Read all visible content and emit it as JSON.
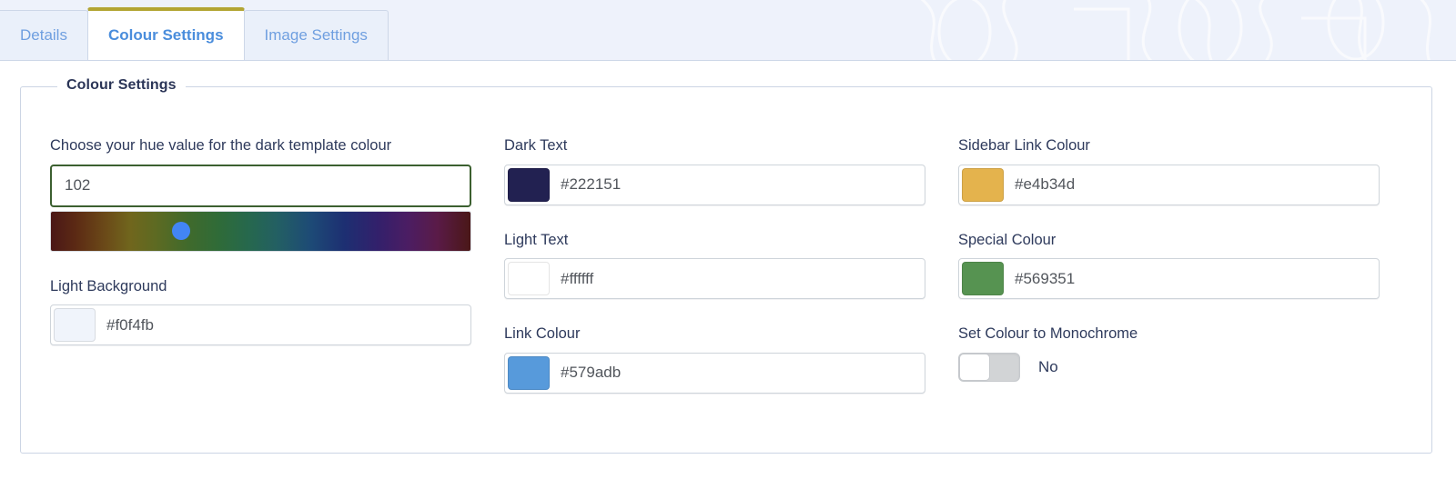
{
  "tabs": [
    {
      "label": "Details",
      "active": false
    },
    {
      "label": "Colour Settings",
      "active": true
    },
    {
      "label": "Image Settings",
      "active": false
    }
  ],
  "fieldset": {
    "legend": "Colour Settings"
  },
  "columns": {
    "left": {
      "hue": {
        "label": "Choose your hue value for the dark template colour",
        "value": "102",
        "slider_position_pct": 31,
        "thumb_colour": "#4285f4",
        "focus_border_colour": "#3c6030"
      },
      "light_background": {
        "label": "Light Background",
        "value": "#f0f4fb",
        "swatch": "#f0f4fb"
      }
    },
    "middle": {
      "dark_text": {
        "label": "Dark Text",
        "value": "#222151",
        "swatch": "#222151"
      },
      "light_text": {
        "label": "Light Text",
        "value": "#ffffff",
        "swatch": "#ffffff"
      },
      "link_colour": {
        "label": "Link Colour",
        "value": "#579adb",
        "swatch": "#579adb"
      }
    },
    "right": {
      "sidebar_link_colour": {
        "label": "Sidebar Link Colour",
        "value": "#e4b34d",
        "swatch": "#e4b34d"
      },
      "special_colour": {
        "label": "Special Colour",
        "value": "#569351",
        "swatch": "#569351"
      },
      "monochrome": {
        "label": "Set Colour to Monochrome",
        "state_label": "No",
        "checked": false
      }
    }
  }
}
